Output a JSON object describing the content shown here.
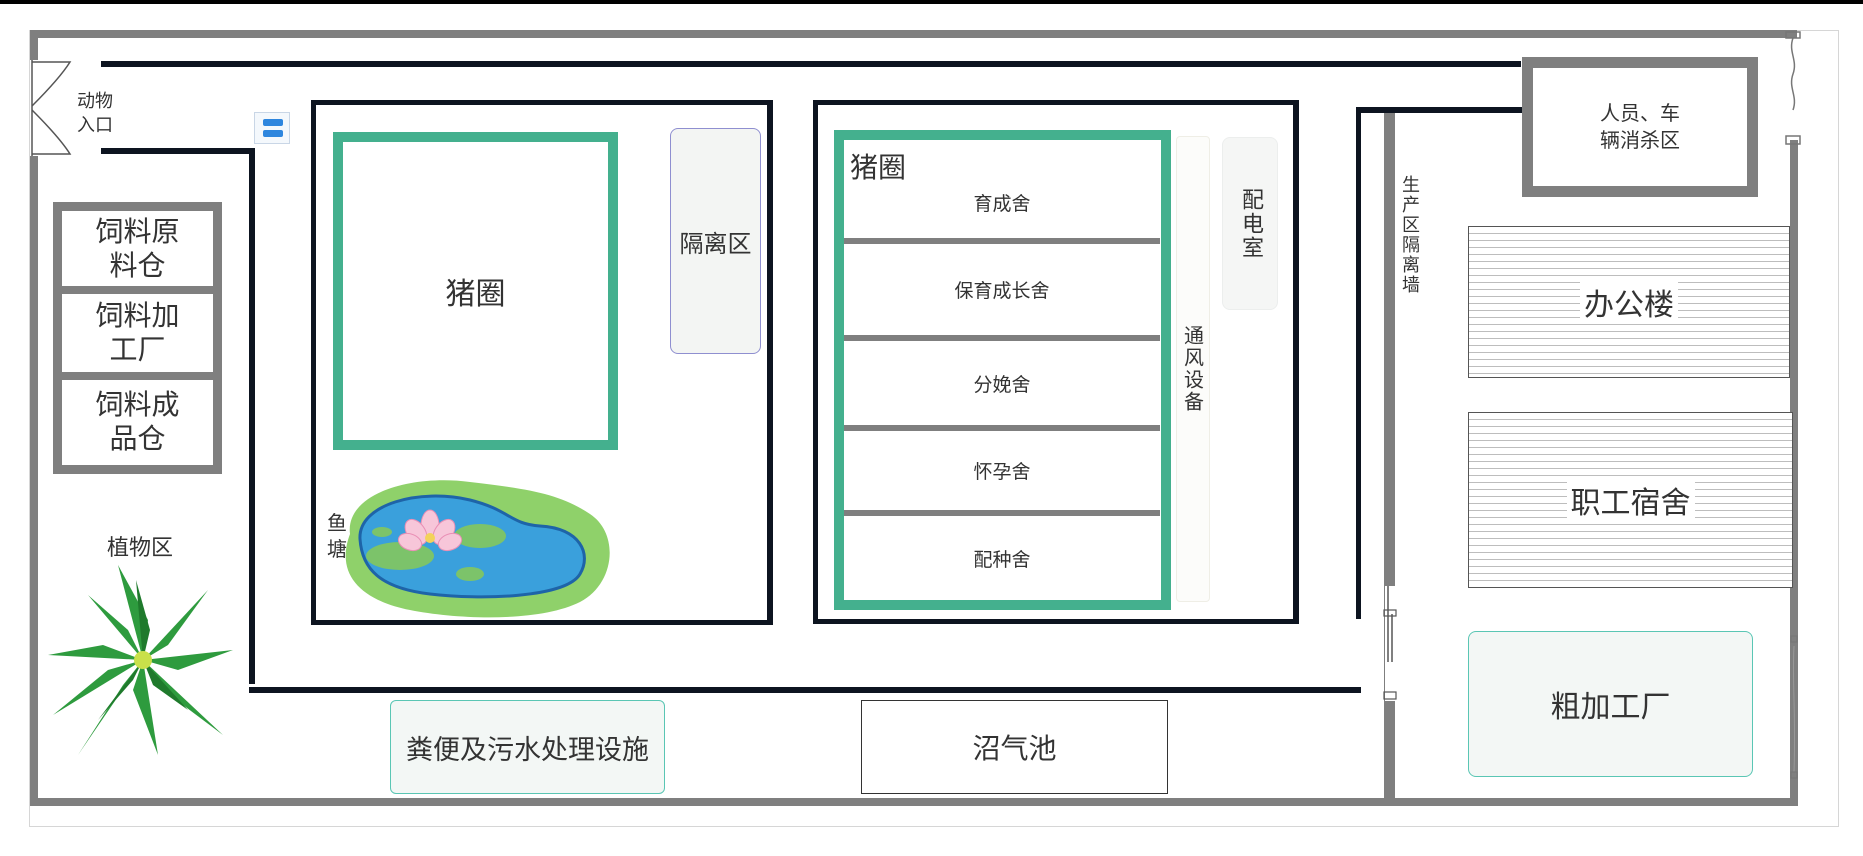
{
  "labels": {
    "animal_entrance": "动物\n入口",
    "feed_raw_warehouse": "饲料原\n料仓",
    "feed_factory": "饲料加\n工厂",
    "feed_product_warehouse": "饲料成\n品仓",
    "plant_area": "植物区",
    "pigpen_left": "猪圈",
    "fish_pond": "鱼\n塘",
    "isolation_area": "隔离区",
    "pigpen_right": "猪圈",
    "barn_rearing": "育成舍",
    "barn_nursery": "保育成长舍",
    "barn_farrowing": "分娩舍",
    "barn_gestation": "怀孕舍",
    "barn_breeding": "配种舍",
    "ventilation": "通风设备",
    "power_room": "配电室",
    "production_wall": "生产区隔离墙",
    "disinfection_area": "人员、车\n辆消杀区",
    "office_building": "办公楼",
    "staff_dorm": "职工宿舍",
    "rough_processing": "粗加工厂",
    "manure_treatment": "粪便及污水处理设施",
    "biogas_tank": "沼气池"
  },
  "colors": {
    "outer_wall": "#7f7f7f",
    "inner_wall": "#0d1420",
    "pen_border": "#44b08e",
    "pond_water": "#3aa0dc",
    "pond_grass": "#8fd16a"
  },
  "icons": {
    "door": "door-icon",
    "server": "server-icon",
    "pond": "pond-icon",
    "plant": "plant-icon"
  }
}
